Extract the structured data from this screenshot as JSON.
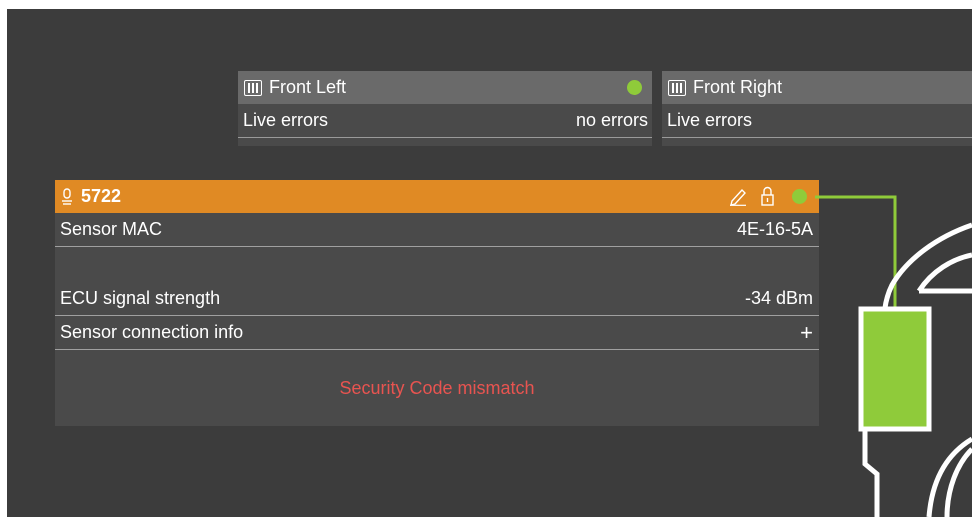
{
  "wheels": [
    {
      "title": "Front Left",
      "status_color": "#8fcb3a",
      "row_label": "Live errors",
      "row_value": "no errors",
      "icon": "tire-icon"
    },
    {
      "title": "Front Right",
      "row_label": "Live errors",
      "row_value": "",
      "icon": "tire-icon"
    }
  ],
  "sensor": {
    "id": "5722",
    "header_color": "#e08a24",
    "status_color": "#8fcb3a",
    "icons": [
      "sensor-icon",
      "edit-icon",
      "lock-icon"
    ],
    "rows": [
      {
        "label": "Sensor MAC",
        "value": "4E-16-5A"
      },
      {
        "label": "ECU signal strength",
        "value": "-34 dBm"
      },
      {
        "label": "Sensor connection info",
        "value": "+"
      }
    ],
    "message": "Security Code mismatch",
    "message_color": "#e85450"
  },
  "connector_color": "#8fcb3a"
}
